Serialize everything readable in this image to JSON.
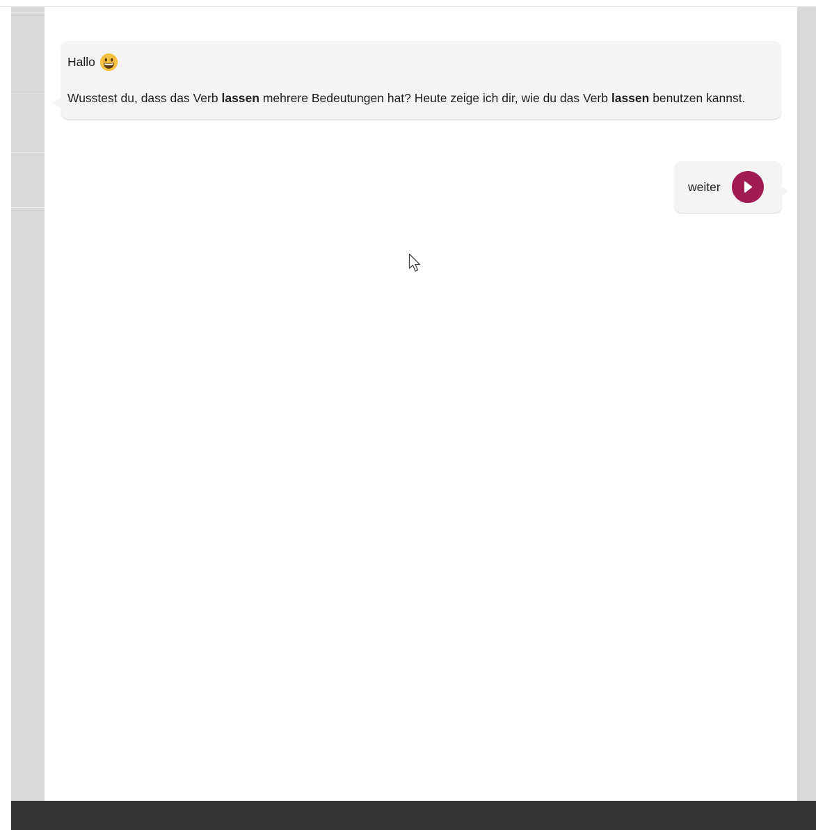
{
  "chat": {
    "greeting": "Hallo",
    "greeting_icon": "grinning-face-icon",
    "message": {
      "part1": "Wusstest du, dass das Verb ",
      "bold1": "lassen",
      "part2": " mehrere Bedeutungen hat? Heute zeige ich dir, wie du das Verb ",
      "bold2": "lassen",
      "part3": " benutzen kannst."
    }
  },
  "next_button": {
    "label": "weiter",
    "icon": "play-icon"
  },
  "colors": {
    "accent": "#a01c50",
    "bubble": "#f4f4f5",
    "rail": "#d9d9d9",
    "bottom_bar": "#353535",
    "smiley": "#f6c141"
  }
}
